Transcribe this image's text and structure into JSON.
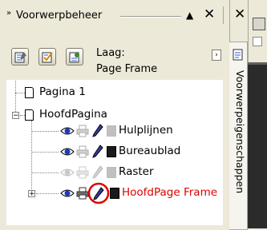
{
  "titlebar": {
    "grip": "»",
    "title": "Voorwerpbeheer",
    "up_icon": "▲",
    "close_icon": "✕"
  },
  "layer": {
    "caption": "Laag:",
    "value": "Page Frame",
    "flyout_icon": "›"
  },
  "tree": {
    "pages": [
      {
        "label": "Pagina 1"
      },
      {
        "label": "HoofdPagina",
        "expander": "−"
      }
    ],
    "layers": [
      {
        "label": "Hulplijnen",
        "swatch": "#c0c0c0",
        "enabled": true,
        "color": "#000000"
      },
      {
        "label": "Bureaublad",
        "swatch": "#1a1a1a",
        "enabled": true,
        "color": "#000000"
      },
      {
        "label": "Raster",
        "swatch": "#c0c0c0",
        "enabled": false,
        "color": "#000000"
      },
      {
        "label": "HoofdPage Frame",
        "swatch": "#1a1a1a",
        "enabled": true,
        "color": "#e00000",
        "expander": "+",
        "highlighted": true
      }
    ]
  },
  "side_tab": {
    "label": "Voorwerpeigenschappen",
    "close_icon": "✕"
  },
  "colors": {
    "accent_red": "#e00000",
    "panel_bg": "#ece9d8"
  }
}
